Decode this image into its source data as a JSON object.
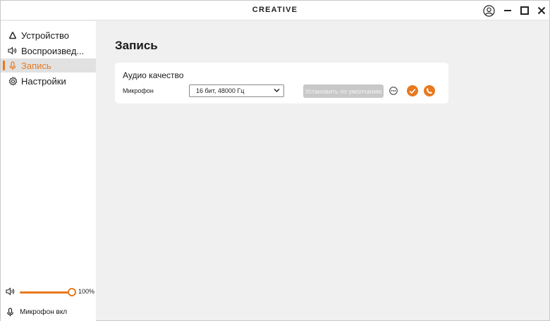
{
  "app": {
    "brand": "CREATIVE"
  },
  "sidebar": {
    "items": [
      {
        "label": "Устройство",
        "icon": "device-icon"
      },
      {
        "label": "Воспроизвед...",
        "icon": "speaker-icon"
      },
      {
        "label": "Запись",
        "icon": "microphone-icon",
        "active": true
      },
      {
        "label": "Настройки",
        "icon": "gear-icon"
      }
    ],
    "volume": {
      "value_text": "100%",
      "level": 1.0
    },
    "mic_status": "Микрофон вкл"
  },
  "main": {
    "title": "Запись",
    "card": {
      "title": "Аудио качество",
      "row_label": "Микрофон",
      "select_value": "16 бит, 48000 Гц",
      "default_button": "Установить по умолчанию"
    }
  },
  "colors": {
    "accent": "#e8791f",
    "sidebar_bg": "#ffffff",
    "content_bg": "#f0f0f0",
    "active_bg": "#e1e1e1"
  }
}
